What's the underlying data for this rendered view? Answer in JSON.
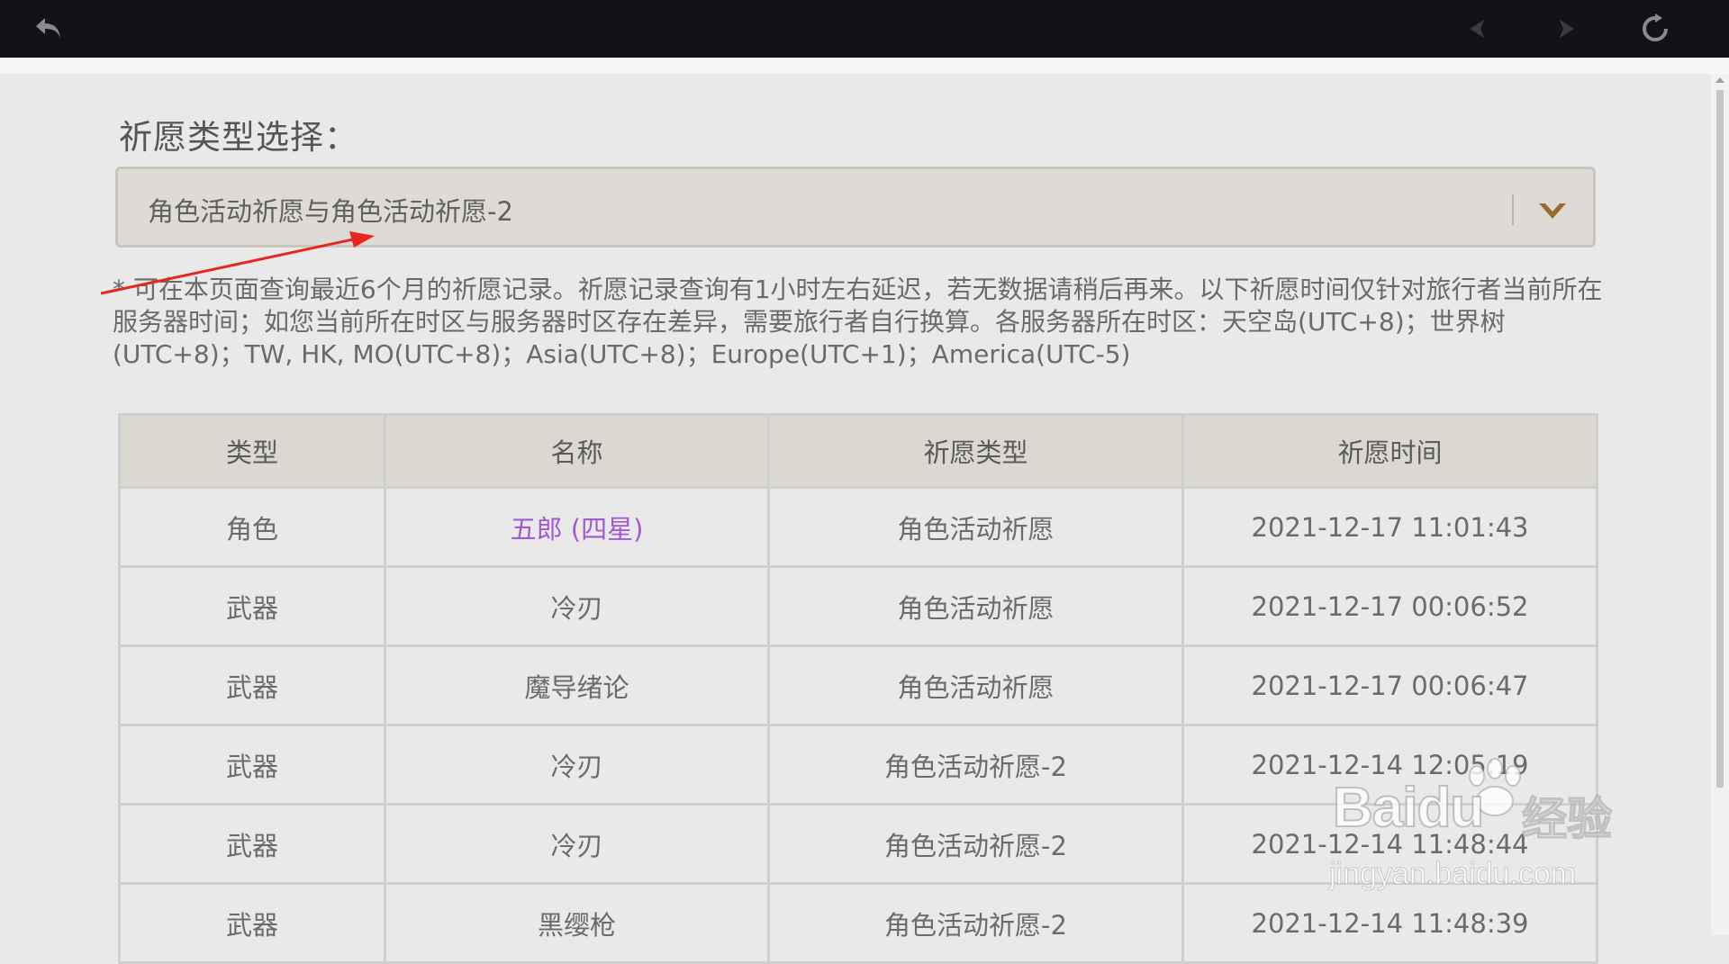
{
  "toolbar": {
    "back_icon": "undo-arrow-icon",
    "prev_icon": "left-arrow-icon",
    "next_icon": "right-arrow-icon",
    "refresh_icon": "refresh-icon"
  },
  "wish_type": {
    "label": "祈愿类型选择：",
    "selected": "角色活动祈愿与角色活动祈愿-2",
    "arrow_icon": "chevron-down-icon"
  },
  "notice": "* 可在本页面查询最近6个月的祈愿记录。祈愿记录查询有1小时左右延迟，若无数据请稍后再来。以下祈愿时间仅针对旅行者当前所在服务器时间；如您当前所在时区与服务器时区存在差异，需要旅行者自行换算。各服务器所在时区：天空岛(UTC+8)；世界树(UTC+8)；TW, HK, MO(UTC+8)；Asia(UTC+8)；Europe(UTC+1)；America(UTC-5)",
  "table": {
    "headers": [
      "类型",
      "名称",
      "祈愿类型",
      "祈愿时间"
    ],
    "rows": [
      [
        "角色",
        "五郎 (四星)",
        "角色活动祈愿",
        "2021-12-17 11:01:43"
      ],
      [
        "武器",
        "冷刃",
        "角色活动祈愿",
        "2021-12-17 00:06:52"
      ],
      [
        "武器",
        "魔导绪论",
        "角色活动祈愿",
        "2021-12-17 00:06:47"
      ],
      [
        "武器",
        "冷刃",
        "角色活动祈愿-2",
        "2021-12-14 12:05:19"
      ],
      [
        "武器",
        "冷刃",
        "角色活动祈愿-2",
        "2021-12-14 11:48:44"
      ],
      [
        "武器",
        "黑缨枪",
        "角色活动祈愿-2",
        "2021-12-14 11:48:39"
      ]
    ]
  },
  "colors": {
    "topbar": "#121318",
    "four_star": "#a25ad0",
    "annotation_arrow": "#e8251f",
    "select_arrow": "#9a6a2a"
  },
  "watermark": {
    "brand": "Baidu",
    "cn": "经验",
    "url": "jingyan.baidu.com"
  }
}
